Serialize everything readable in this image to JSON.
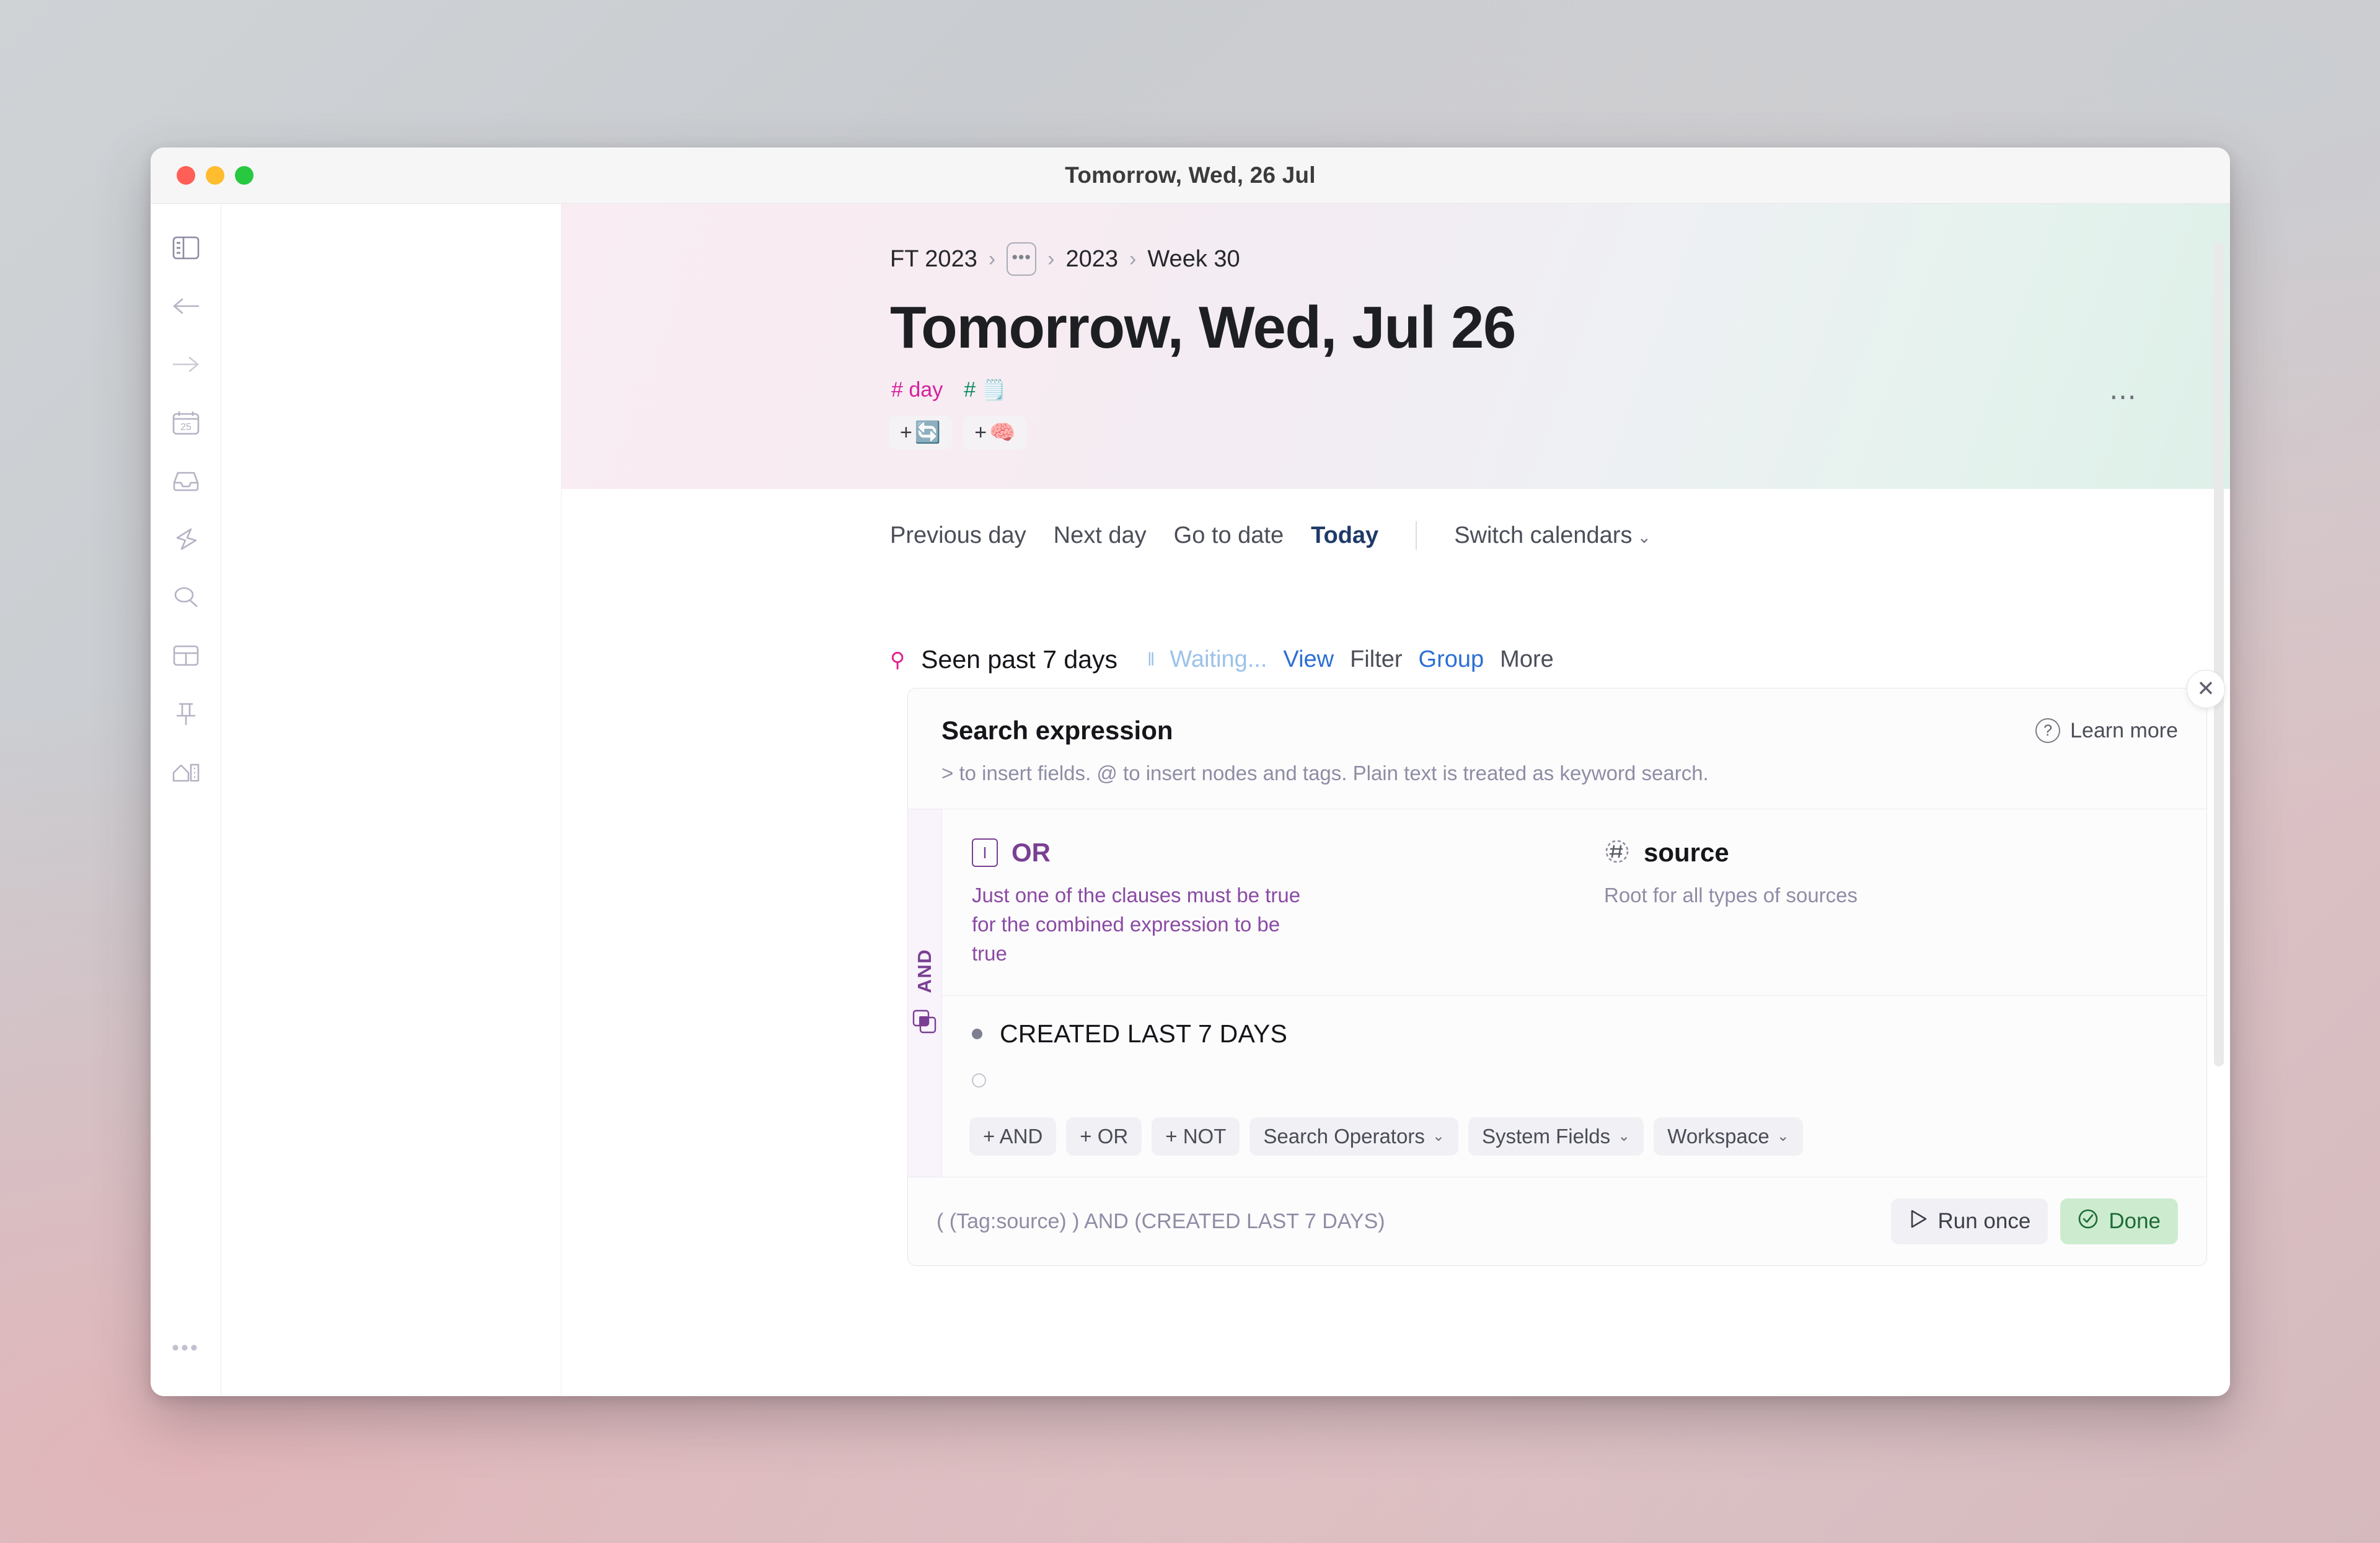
{
  "window": {
    "title": "Tomorrow, Wed, 26 Jul"
  },
  "sidebar": {
    "items": [
      {
        "name": "toggle-sidebar-icon"
      },
      {
        "name": "back-arrow-icon"
      },
      {
        "name": "forward-arrow-icon"
      },
      {
        "name": "calendar-icon",
        "label": "25"
      },
      {
        "name": "inbox-icon"
      },
      {
        "name": "flash-icon"
      },
      {
        "name": "search-icon"
      },
      {
        "name": "layout-icon"
      },
      {
        "name": "pin-icon"
      },
      {
        "name": "home-icon"
      }
    ],
    "overflow_label": "•••"
  },
  "header": {
    "back_caret": "‹",
    "breadcrumb": [
      "FT 2023",
      "2023",
      "Week 30"
    ],
    "breadcrumb_separator": "›",
    "breadcrumb_ellipsis": "•••",
    "title": "Tomorrow, Wed, Jul 26",
    "tags": [
      {
        "hash": "#",
        "label": "day"
      },
      {
        "hash": "#",
        "label": "🗒️"
      }
    ],
    "chips": [
      {
        "plus": "+",
        "emoji": "🔄"
      },
      {
        "plus": "+",
        "emoji": "🧠"
      }
    ],
    "more_label": "⋯"
  },
  "daynav": {
    "previous_day": "Previous day",
    "next_day": "Next day",
    "go_to_date": "Go to date",
    "today": "Today",
    "switch_calendars": "Switch calendars",
    "caret": "⌄"
  },
  "search": {
    "title": "Seen past 7 days",
    "status": "Waiting...",
    "pause_icon": "‖",
    "magnifier": "⚲",
    "actions": [
      {
        "label": "View",
        "active": true
      },
      {
        "label": "Filter",
        "active": false
      },
      {
        "label": "Group",
        "active": true
      },
      {
        "label": "More",
        "active": false
      }
    ]
  },
  "panel": {
    "heading": "Search expression",
    "hint": "> to insert fields. @ to insert nodes and tags. Plain text is treated as keyword search.",
    "learn_more": "Learn more",
    "close_label": "✕",
    "group_operator": "AND",
    "clauses": [
      {
        "name": "OR",
        "description": "Just one of the clauses must be true for the combined expression to be true",
        "icon": "text-cursor-box-icon"
      },
      {
        "name": "source",
        "description": "Root for all types of sources",
        "icon": "tag-hash-icon"
      }
    ],
    "simple_clause": "CREATED LAST 7 DAYS",
    "buttons": [
      {
        "label": "+ AND",
        "dropdown": false
      },
      {
        "label": "+ OR",
        "dropdown": false
      },
      {
        "label": "+ NOT",
        "dropdown": false
      },
      {
        "label": "Search Operators",
        "dropdown": true
      },
      {
        "label": "System Fields",
        "dropdown": true
      },
      {
        "label": "Workspace",
        "dropdown": true
      }
    ],
    "dropdown_caret": "⌄",
    "expression": "( (Tag:source) ) AND (CREATED LAST 7 DAYS)",
    "run_once": "Run once",
    "done": "Done"
  },
  "colors": {
    "accent_blue": "#2c6fd4",
    "accent_purple": "#7a3f92",
    "accent_magenta": "#d6219c",
    "done_green": "#1d6b38",
    "waiting_blue": "#9cc2ea"
  }
}
